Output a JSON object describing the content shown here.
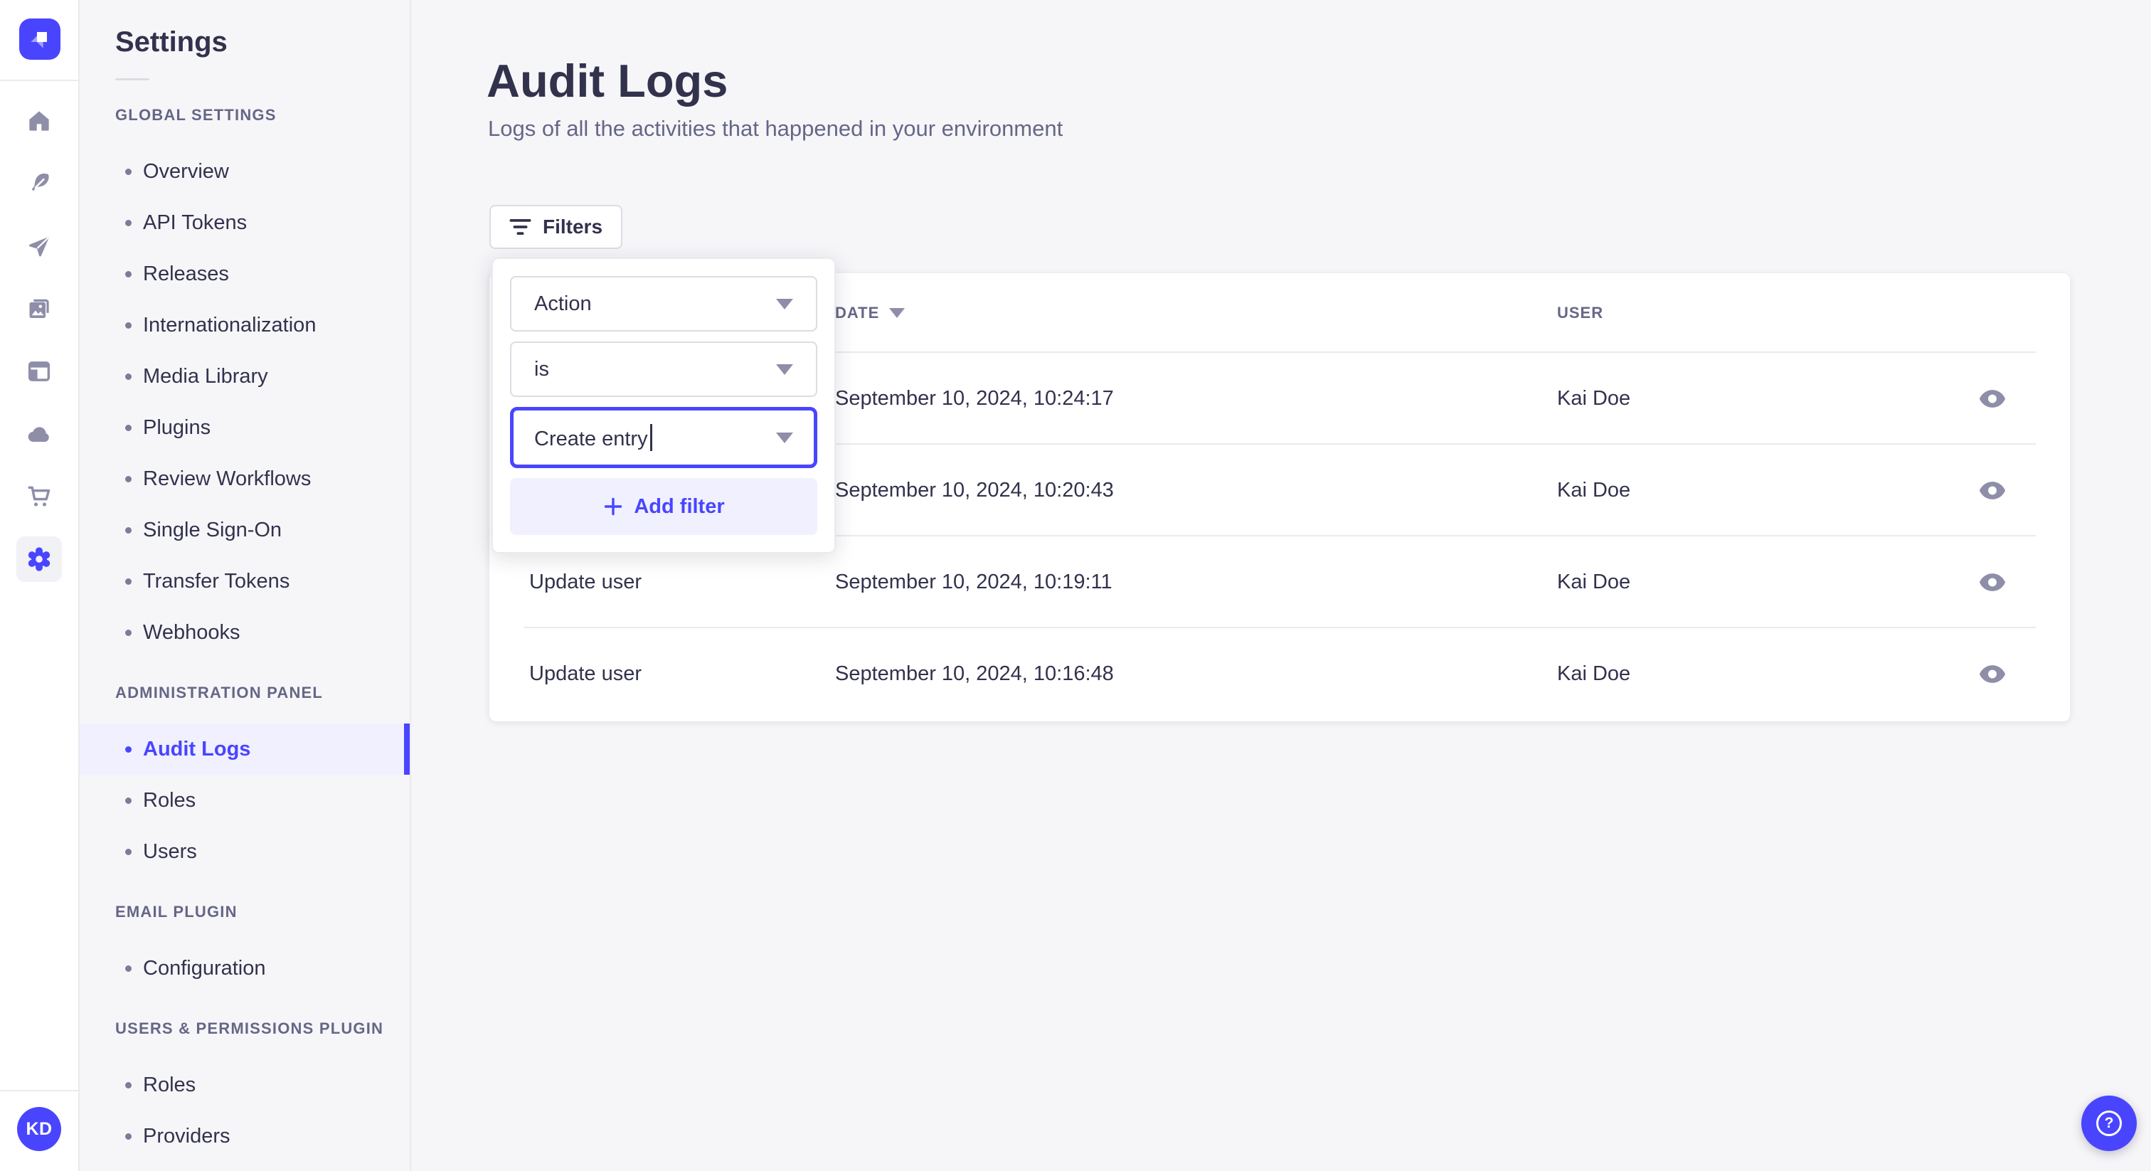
{
  "colors": {
    "accent": "#4945ff",
    "accent_light": "#f0f0ff",
    "text": "#32324d",
    "text_muted": "#666687",
    "icon_gray": "#8e8ea9",
    "border": "#dcdce4",
    "divider": "#eaeaef",
    "background": "#f6f6f9",
    "surface": "#ffffff"
  },
  "rail": {
    "logo_icon": "strapi-logo",
    "icons": [
      "home-icon",
      "feather-icon",
      "paper-plane-icon",
      "media-library-icon",
      "layout-icon",
      "cloud-icon",
      "shopping-cart-icon",
      "gear-icon"
    ],
    "active_icon": "gear-icon",
    "avatar_initials": "KD"
  },
  "sidebar": {
    "title": "Settings",
    "active_item": "Audit Logs",
    "sections": [
      {
        "label": "GLOBAL SETTINGS",
        "items": [
          "Overview",
          "API Tokens",
          "Releases",
          "Internationalization",
          "Media Library",
          "Plugins",
          "Review Workflows",
          "Single Sign-On",
          "Transfer Tokens",
          "Webhooks"
        ]
      },
      {
        "label": "ADMINISTRATION PANEL",
        "items": [
          "Audit Logs",
          "Roles",
          "Users"
        ]
      },
      {
        "label": "EMAIL PLUGIN",
        "items": [
          "Configuration"
        ]
      },
      {
        "label": "USERS & PERMISSIONS PLUGIN",
        "items": [
          "Roles",
          "Providers"
        ]
      }
    ]
  },
  "main": {
    "page_title": "Audit Logs",
    "page_subtitle": "Logs of all the activities that happened in your environment",
    "filters_button_label": "Filters",
    "filter_popover": {
      "field_value": "Action",
      "operator_value": "is",
      "value_text": "Create entry",
      "add_filter_label": "Add filter"
    },
    "table": {
      "columns": {
        "date": "DATE",
        "user": "USER"
      },
      "sort": {
        "column": "DATE",
        "direction": "desc"
      },
      "rows": [
        {
          "action": "",
          "date": "September 10, 2024, 10:24:17",
          "user": "Kai Doe"
        },
        {
          "action": "",
          "date": "September 10, 2024, 10:20:43",
          "user": "Kai Doe"
        },
        {
          "action": "Update user",
          "date": "September 10, 2024, 10:19:11",
          "user": "Kai Doe"
        },
        {
          "action": "Update user",
          "date": "September 10, 2024, 10:16:48",
          "user": "Kai Doe"
        }
      ]
    },
    "help_question_mark": "?"
  }
}
